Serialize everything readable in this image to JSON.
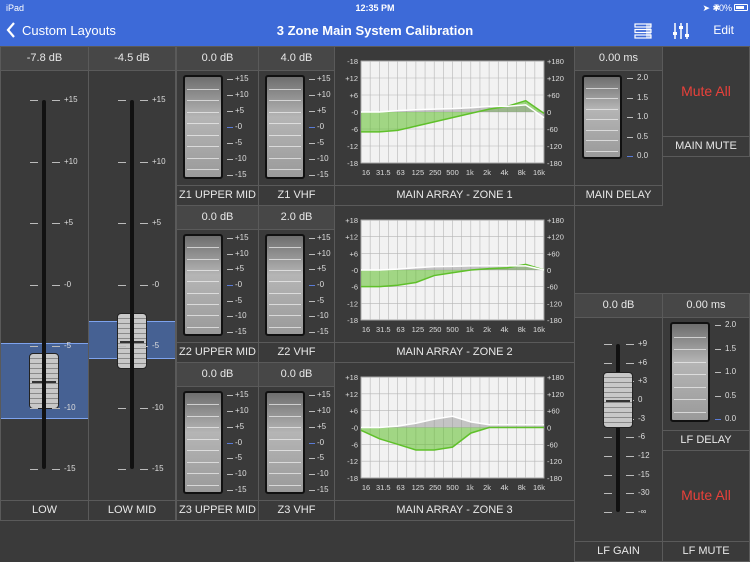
{
  "status": {
    "device": "iPad",
    "time": "12:35 PM",
    "battery": "70%"
  },
  "nav": {
    "back_label": "Custom Layouts",
    "title": "3 Zone Main System Calibration",
    "edit_label": "Edit"
  },
  "fader_ticks": [
    "+15",
    "+10",
    "+5",
    "-0",
    "-5",
    "-10",
    "-15"
  ],
  "meter_ticks": [
    "+15",
    "+10",
    "+5",
    "-0",
    "-5",
    "-10",
    "-15"
  ],
  "eq_x_ticks": [
    "16",
    "31.5",
    "63",
    "125",
    "250",
    "500",
    "1k",
    "2k",
    "4k",
    "8k",
    "16k"
  ],
  "eq_left_ticks": [
    "18",
    "12",
    "6",
    "0",
    "-6",
    "-12",
    "-18"
  ],
  "eq_right_ticks": [
    "+180",
    "+120",
    "+60",
    "0",
    "-60",
    "-120",
    "-180"
  ],
  "eq_left_ticks_z1": [
    "-18",
    "+12",
    "+6",
    "-0",
    "-6",
    "-12",
    "-18"
  ],
  "eq_left_ticks_z2": [
    "+18",
    "+12",
    "+6",
    "-0",
    "-6",
    "-12",
    "-18"
  ],
  "eq_left_ticks_z3": [
    "+18",
    "+12",
    "+6",
    "-0",
    "-6",
    "-12",
    "-18"
  ],
  "delay_ticks": [
    "2.0",
    "1.5",
    "1.0",
    "0.5",
    "0.0"
  ],
  "lf_gain_ticks": [
    "+9",
    "+6",
    "+3",
    "0",
    "-3",
    "-6",
    "-12",
    "-15",
    "-30",
    "-∞"
  ],
  "low": {
    "value": "-7.8 dB",
    "label": "LOW",
    "level_db": -7.8
  },
  "low_mid": {
    "value": "-4.5 dB",
    "label": "LOW MID",
    "level_db": -4.5
  },
  "z1_upper_mid": {
    "value": "0.0 dB",
    "label": "Z1 UPPER MID"
  },
  "z1_vhf": {
    "value": "4.0 dB",
    "label": "Z1 VHF"
  },
  "z2_upper_mid": {
    "value": "0.0 dB",
    "label": "Z2 UPPER MID"
  },
  "z2_vhf": {
    "value": "2.0 dB",
    "label": "Z2 VHF"
  },
  "z3_upper_mid": {
    "value": "0.0 dB",
    "label": "Z3 UPPER MID"
  },
  "z3_vhf": {
    "value": "0.0 dB",
    "label": "Z3 VHF"
  },
  "eq_zone1": {
    "label": "MAIN ARRAY - ZONE 1"
  },
  "eq_zone2": {
    "label": "MAIN ARRAY - ZONE 2"
  },
  "eq_zone3": {
    "label": "MAIN ARRAY - ZONE 3"
  },
  "main_delay": {
    "value": "0.00 ms",
    "label": "MAIN DELAY"
  },
  "main_mute": {
    "button_label": "Mute All",
    "label": "MAIN MUTE"
  },
  "lf_gain": {
    "value": "0.0 dB",
    "label": "LF GAIN"
  },
  "lf_delay": {
    "value": "0.00 ms",
    "label": "LF DELAY"
  },
  "lf_mute": {
    "button_label": "Mute All",
    "label": "LF MUTE"
  },
  "colors": {
    "nav_blue": "#3d6ad8",
    "mute_red": "#e8413a",
    "eq_green": "#5fc02a",
    "fader_highlight": "#5082dc"
  }
}
